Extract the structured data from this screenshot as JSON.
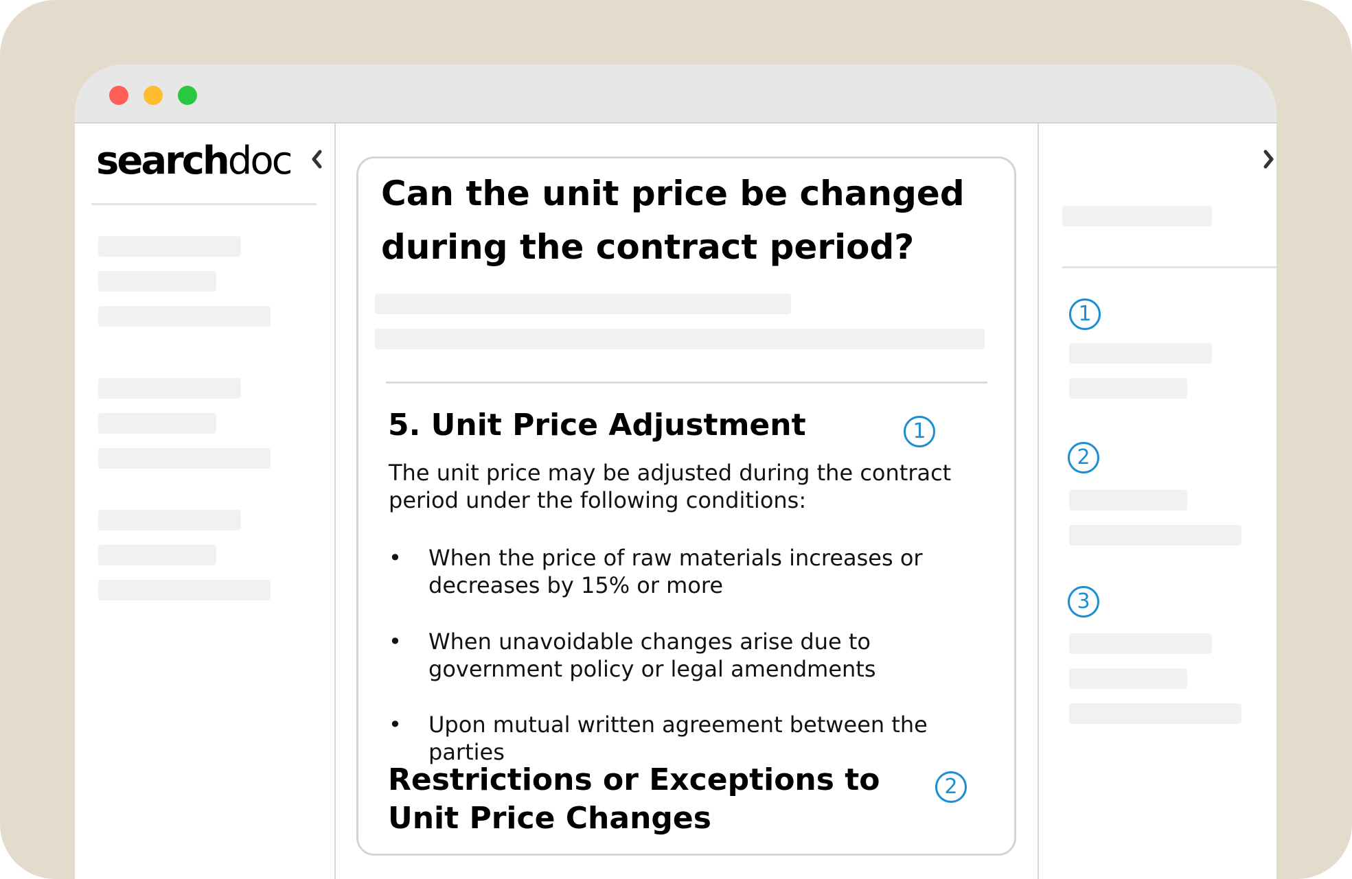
{
  "app": {
    "logo_bold": "search",
    "logo_light": "doc"
  },
  "document": {
    "question": "Can the unit price be changed during the contract period?",
    "section_title": "5. Unit Price Adjustment",
    "section_citation": "1",
    "intro": "The unit price may be adjusted during the contract period under the following conditions:",
    "bullets": [
      {
        "mark": "•",
        "text": "When the price of raw materials increases or decreases by 15% or more"
      },
      {
        "mark": "•",
        "text": "When unavoidable changes arise due to government policy or legal amendments"
      },
      {
        "mark": "•",
        "text": "Upon mutual written agreement between the parties"
      }
    ],
    "section2_title": "Restrictions or Exceptions to Unit Price Changes",
    "section2_citation": "2"
  },
  "references": {
    "items": [
      {
        "number": "1"
      },
      {
        "number": "2"
      },
      {
        "number": "3"
      }
    ]
  },
  "icons": {
    "collapse_left": "chevron-left-icon",
    "collapse_right": "chevron-right-icon"
  },
  "colors": {
    "background": "#e3dccd",
    "titlebar": "#e7e7e7",
    "citation": "#1b8fd1",
    "skeleton": "#f1f1f1",
    "traffic_red": "#ff5f57",
    "traffic_yellow": "#febc2e",
    "traffic_green": "#28c840"
  }
}
